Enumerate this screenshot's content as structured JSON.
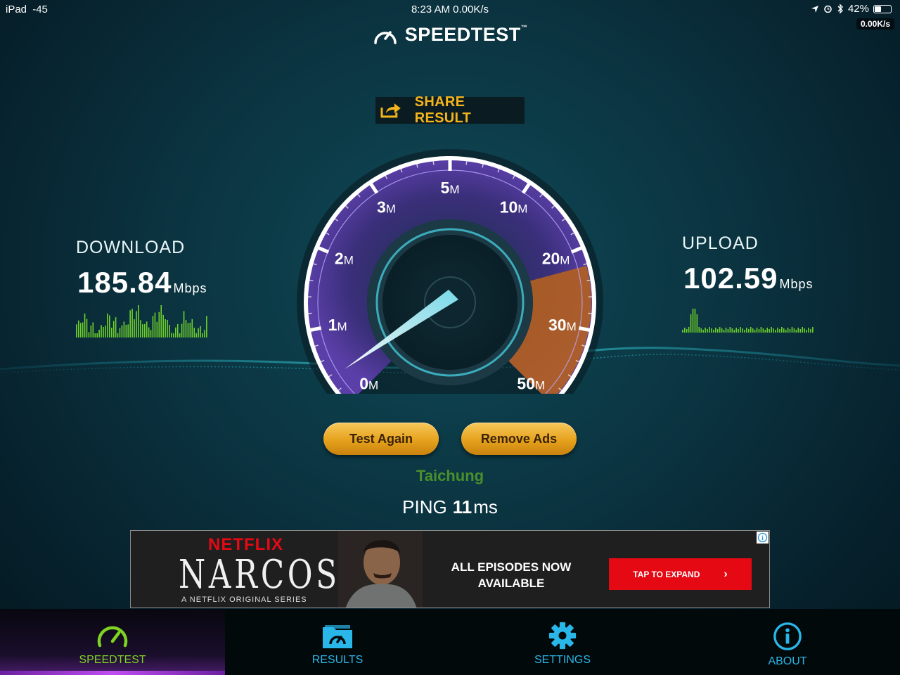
{
  "status_bar": {
    "carrier": "iPad",
    "signal": "-45",
    "time_speed": "8:23 AM 0.00K/s",
    "battery": "42%",
    "battery_level": 0.42,
    "net_speed": "0.00K/s"
  },
  "header": {
    "title": "SPEEDTEST",
    "trademark": "™"
  },
  "share": {
    "label": "SHARE RESULT"
  },
  "download": {
    "label": "DOWNLOAD",
    "value": "185.84",
    "unit": "Mbps"
  },
  "upload": {
    "label": "UPLOAD",
    "value": "102.59",
    "unit": "Mbps"
  },
  "gauge": {
    "ticks": [
      {
        "num": "0",
        "unit": "M"
      },
      {
        "num": "1",
        "unit": "M"
      },
      {
        "num": "2",
        "unit": "M"
      },
      {
        "num": "3",
        "unit": "M"
      },
      {
        "num": "5",
        "unit": "M"
      },
      {
        "num": "10",
        "unit": "M"
      },
      {
        "num": "20",
        "unit": "M"
      },
      {
        "num": "30",
        "unit": "M"
      },
      {
        "num": "50",
        "unit": "M"
      }
    ]
  },
  "buttons": {
    "test_again": "Test Again",
    "remove_ads": "Remove Ads"
  },
  "server": {
    "name": "Taichung"
  },
  "ping": {
    "label": "PING",
    "value": "11",
    "unit": "ms"
  },
  "ad": {
    "brand": "NETFLIX",
    "title": "NARCOS",
    "subtitle": "A NETFLIX ORIGINAL SERIES",
    "message_line1": "ALL EPISODES NOW",
    "message_line2": "AVAILABLE",
    "cta": "TAP TO EXPAND",
    "cta_arrow": "›",
    "info": "i"
  },
  "tabs": [
    {
      "label": "SPEEDTEST",
      "icon": "speedometer-icon",
      "color": "#7fd321",
      "active": true
    },
    {
      "label": "RESULTS",
      "icon": "folder-gauge-icon",
      "color": "#29b6e8",
      "active": false
    },
    {
      "label": "SETTINGS",
      "icon": "gear-icon",
      "color": "#29b6e8",
      "active": false
    },
    {
      "label": "ABOUT",
      "icon": "info-icon",
      "color": "#29b6e8",
      "active": false
    }
  ],
  "colors": {
    "accent_orange": "#f5b41c",
    "tab_active": "#7fd321",
    "tab_inactive": "#29b6e8",
    "server_green": "#4a8f2c",
    "ad_red": "#e50914"
  }
}
